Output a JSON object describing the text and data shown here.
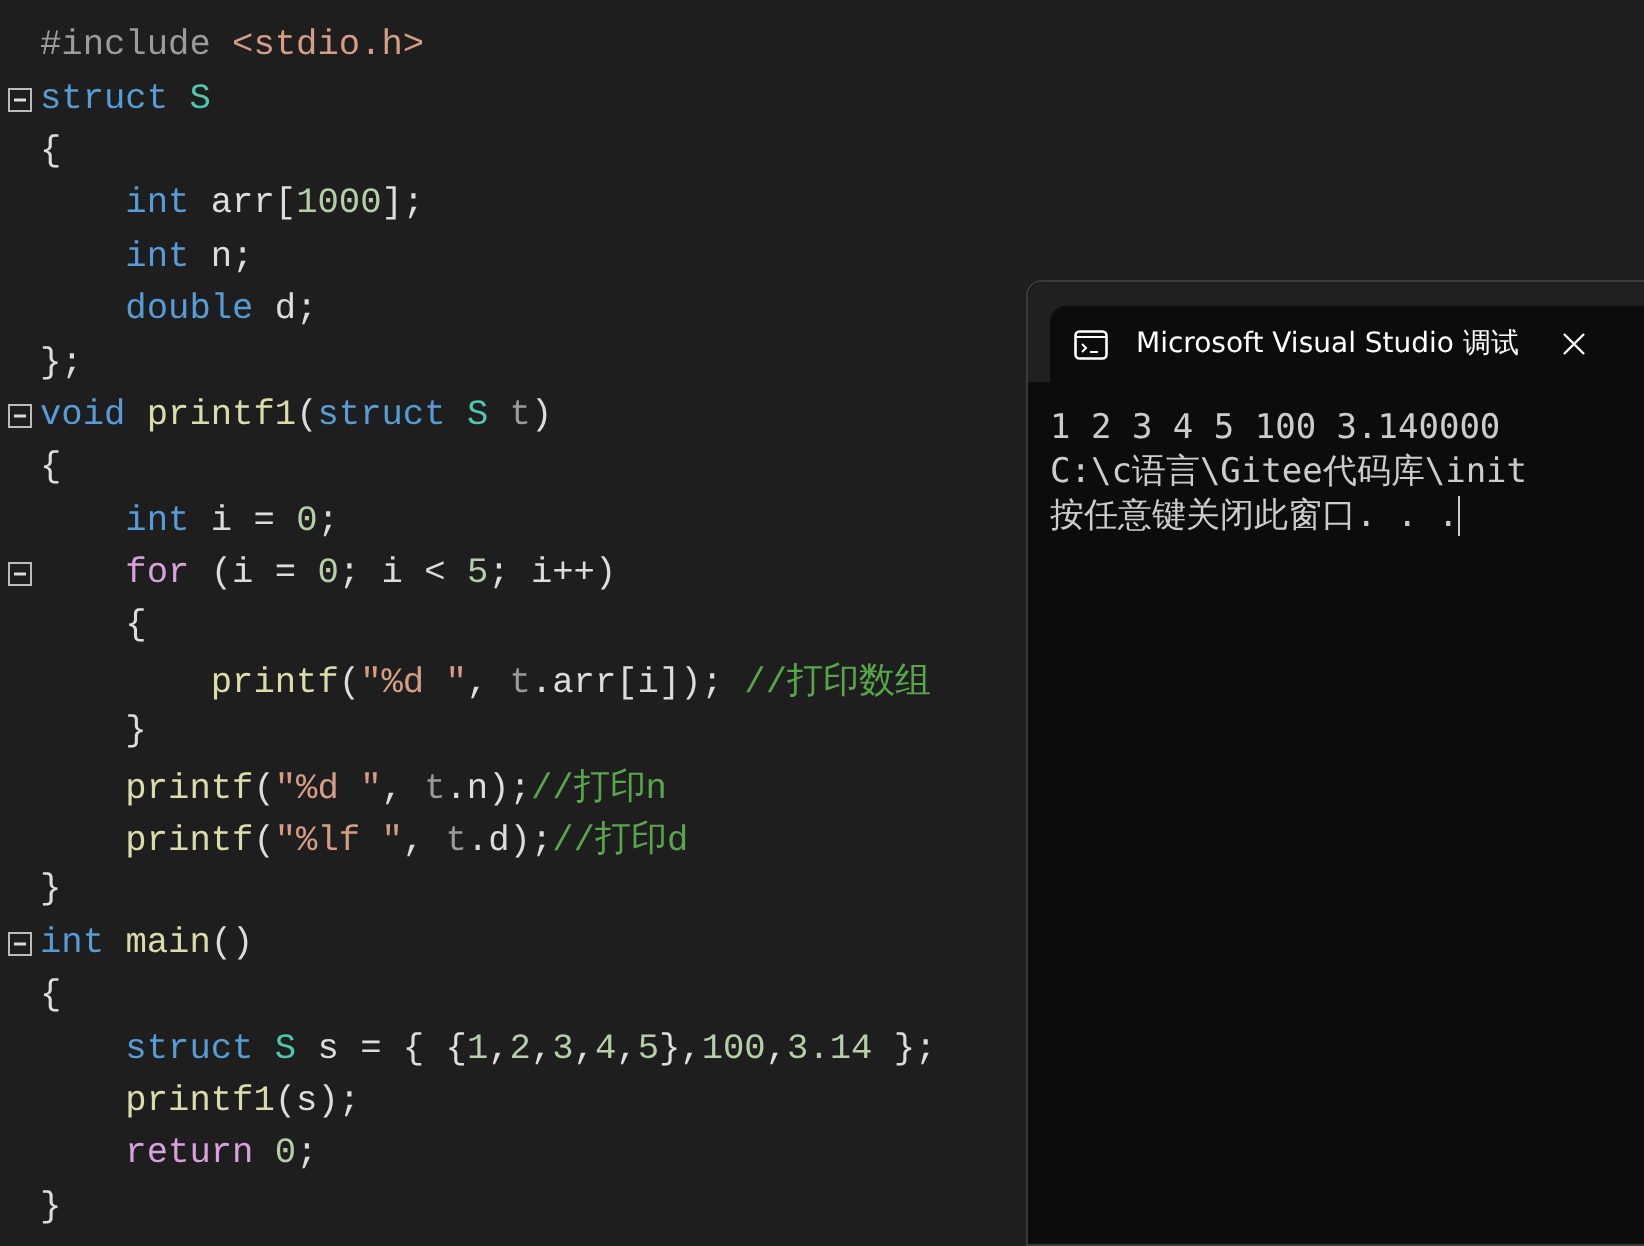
{
  "editor": {
    "lines": [
      {
        "foldable": false,
        "tokens": [
          {
            "text": "#include ",
            "kind": "pre"
          },
          {
            "text": "<stdio.h>",
            "kind": "str"
          }
        ]
      },
      {
        "foldable": true,
        "tokens": [
          {
            "text": "struct ",
            "kind": "kw"
          },
          {
            "text": "S",
            "kind": "type"
          }
        ]
      },
      {
        "foldable": false,
        "tokens": [
          {
            "text": "{",
            "kind": "plain"
          }
        ]
      },
      {
        "foldable": false,
        "tokens": [
          {
            "text": "    int ",
            "kind": "kw"
          },
          {
            "text": "arr[",
            "kind": "plain"
          },
          {
            "text": "1000",
            "kind": "num"
          },
          {
            "text": "];",
            "kind": "plain"
          }
        ]
      },
      {
        "foldable": false,
        "tokens": [
          {
            "text": "    int ",
            "kind": "kw"
          },
          {
            "text": "n;",
            "kind": "plain"
          }
        ]
      },
      {
        "foldable": false,
        "tokens": [
          {
            "text": "    double ",
            "kind": "kw"
          },
          {
            "text": "d;",
            "kind": "plain"
          }
        ]
      },
      {
        "foldable": false,
        "tokens": [
          {
            "text": "};",
            "kind": "plain"
          }
        ]
      },
      {
        "foldable": true,
        "tokens": [
          {
            "text": "void ",
            "kind": "kw"
          },
          {
            "text": "printf1",
            "kind": "fn"
          },
          {
            "text": "(",
            "kind": "plain"
          },
          {
            "text": "struct ",
            "kind": "kw"
          },
          {
            "text": "S ",
            "kind": "type"
          },
          {
            "text": "t",
            "kind": "param"
          },
          {
            "text": ")",
            "kind": "plain"
          }
        ]
      },
      {
        "foldable": false,
        "tokens": [
          {
            "text": "{",
            "kind": "plain"
          }
        ]
      },
      {
        "foldable": false,
        "tokens": [
          {
            "text": "    int ",
            "kind": "kw"
          },
          {
            "text": "i = ",
            "kind": "plain"
          },
          {
            "text": "0",
            "kind": "num"
          },
          {
            "text": ";",
            "kind": "plain"
          }
        ]
      },
      {
        "foldable": true,
        "tokens": [
          {
            "text": "    for ",
            "kind": "ctrl"
          },
          {
            "text": "(i = ",
            "kind": "plain"
          },
          {
            "text": "0",
            "kind": "num"
          },
          {
            "text": "; i < ",
            "kind": "plain"
          },
          {
            "text": "5",
            "kind": "num"
          },
          {
            "text": "; i++)",
            "kind": "plain"
          }
        ]
      },
      {
        "foldable": false,
        "tokens": [
          {
            "text": "    {",
            "kind": "plain"
          }
        ]
      },
      {
        "foldable": false,
        "tokens": [
          {
            "text": "        printf",
            "kind": "fn"
          },
          {
            "text": "(",
            "kind": "plain"
          },
          {
            "text": "\"%d \"",
            "kind": "str"
          },
          {
            "text": ", ",
            "kind": "plain"
          },
          {
            "text": "t",
            "kind": "param"
          },
          {
            "text": ".arr[i]); ",
            "kind": "plain"
          },
          {
            "text": "//打印数组",
            "kind": "comment"
          }
        ]
      },
      {
        "foldable": false,
        "tokens": [
          {
            "text": "    }",
            "kind": "plain"
          }
        ]
      },
      {
        "foldable": false,
        "tokens": [
          {
            "text": "    printf",
            "kind": "fn"
          },
          {
            "text": "(",
            "kind": "plain"
          },
          {
            "text": "\"%d \"",
            "kind": "str"
          },
          {
            "text": ", ",
            "kind": "plain"
          },
          {
            "text": "t",
            "kind": "param"
          },
          {
            "text": ".n);",
            "kind": "plain"
          },
          {
            "text": "//打印n",
            "kind": "comment"
          }
        ]
      },
      {
        "foldable": false,
        "tokens": [
          {
            "text": "    printf",
            "kind": "fn"
          },
          {
            "text": "(",
            "kind": "plain"
          },
          {
            "text": "\"%lf \"",
            "kind": "str"
          },
          {
            "text": ", ",
            "kind": "plain"
          },
          {
            "text": "t",
            "kind": "param"
          },
          {
            "text": ".d);",
            "kind": "plain"
          },
          {
            "text": "//打印d",
            "kind": "comment"
          }
        ]
      },
      {
        "foldable": false,
        "tokens": [
          {
            "text": "}",
            "kind": "plain"
          }
        ]
      },
      {
        "foldable": true,
        "tokens": [
          {
            "text": "int ",
            "kind": "kw"
          },
          {
            "text": "main",
            "kind": "fn"
          },
          {
            "text": "()",
            "kind": "plain"
          }
        ]
      },
      {
        "foldable": false,
        "tokens": [
          {
            "text": "{",
            "kind": "plain"
          }
        ]
      },
      {
        "foldable": false,
        "tokens": [
          {
            "text": "    struct ",
            "kind": "kw"
          },
          {
            "text": "S ",
            "kind": "type"
          },
          {
            "text": "s = { {",
            "kind": "plain"
          },
          {
            "text": "1",
            "kind": "num"
          },
          {
            "text": ",",
            "kind": "plain"
          },
          {
            "text": "2",
            "kind": "num"
          },
          {
            "text": ",",
            "kind": "plain"
          },
          {
            "text": "3",
            "kind": "num"
          },
          {
            "text": ",",
            "kind": "plain"
          },
          {
            "text": "4",
            "kind": "num"
          },
          {
            "text": ",",
            "kind": "plain"
          },
          {
            "text": "5",
            "kind": "num"
          },
          {
            "text": "},",
            "kind": "plain"
          },
          {
            "text": "100",
            "kind": "num"
          },
          {
            "text": ",",
            "kind": "plain"
          },
          {
            "text": "3.14",
            "kind": "num"
          },
          {
            "text": " };",
            "kind": "plain"
          }
        ]
      },
      {
        "foldable": false,
        "tokens": [
          {
            "text": "    printf1",
            "kind": "fn"
          },
          {
            "text": "(s);",
            "kind": "plain"
          }
        ]
      },
      {
        "foldable": false,
        "tokens": [
          {
            "text": "    return ",
            "kind": "ctrl"
          },
          {
            "text": "0",
            "kind": "num"
          },
          {
            "text": ";",
            "kind": "plain"
          }
        ]
      },
      {
        "foldable": false,
        "tokens": [
          {
            "text": "}",
            "kind": "plain"
          }
        ]
      }
    ]
  },
  "console": {
    "title": "Microsoft Visual Studio 调试",
    "lines": [
      "1 2 3 4 5 100 3.140000",
      "C:\\c语言\\Gitee代码库\\init",
      "按任意键关闭此窗口. . ."
    ]
  }
}
